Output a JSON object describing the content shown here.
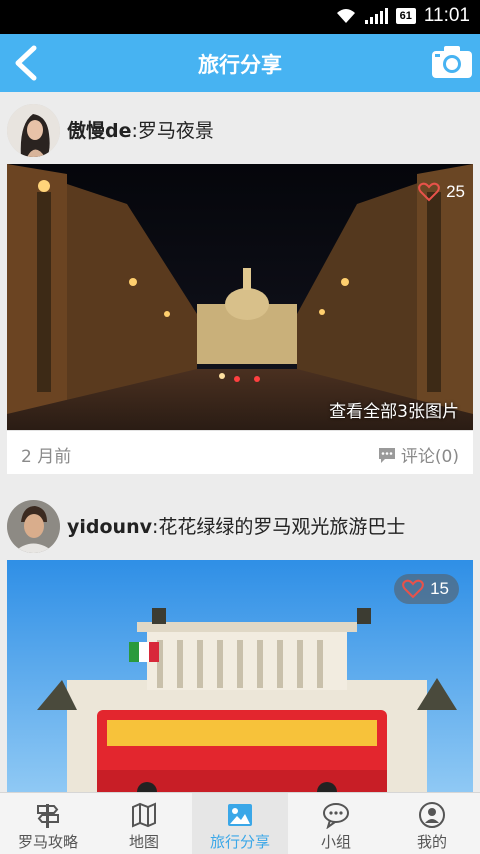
{
  "status_bar": {
    "time": "11:01",
    "battery": "61"
  },
  "header": {
    "title": "旅行分享"
  },
  "posts": [
    {
      "user": "傲慢de",
      "title": "罗马夜景",
      "likes": "25",
      "more_photos": "查看全部3张图片",
      "time": "2 月前",
      "comments": "评论(0)"
    },
    {
      "user": "yidounv",
      "title": "花花绿绿的罗马观光旅游巴士",
      "likes": "15"
    }
  ],
  "bottom_nav": [
    {
      "label": "罗马攻略",
      "icon": "signpost-icon"
    },
    {
      "label": "地图",
      "icon": "map-icon"
    },
    {
      "label": "旅行分享",
      "icon": "photo-icon",
      "active": true
    },
    {
      "label": "小组",
      "icon": "chat-bubbles-icon"
    },
    {
      "label": "我的",
      "icon": "profile-icon"
    }
  ],
  "colors": {
    "accent": "#47b3f2",
    "nav_active": "#3aa7e8",
    "heart": "#e8524a"
  }
}
